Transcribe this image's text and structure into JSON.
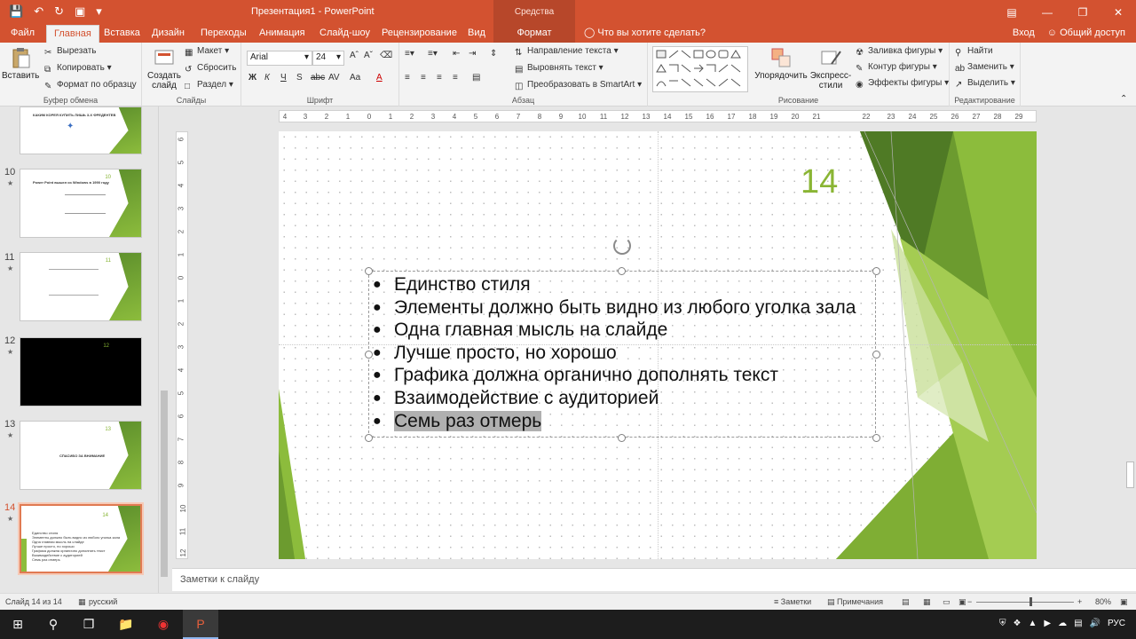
{
  "titlebar": {
    "title": "Презентация1 - PowerPoint",
    "context_group": "Средства рисования"
  },
  "tabs": {
    "items": [
      "Файл",
      "Главная",
      "Вставка",
      "Дизайн",
      "Переходы",
      "Анимация",
      "Слайд-шоу",
      "Рецензирование",
      "Вид"
    ],
    "context_tab": "Формат",
    "tell_me": "Что вы хотите сделать?",
    "signin": "Вход",
    "share": "Общий доступ"
  },
  "ribbon": {
    "clipboard": {
      "paste": "Вставить",
      "cut": "Вырезать",
      "copy": "Копировать",
      "format_painter": "Формат по образцу",
      "group": "Буфер обмена"
    },
    "slides": {
      "new_slide": "Создать слайд",
      "layout": "Макет",
      "reset": "Сбросить",
      "section": "Раздел",
      "group": "Слайды"
    },
    "font": {
      "name": "Arial",
      "size": "24",
      "group": "Шрифт"
    },
    "paragraph": {
      "text_direction": "Направление текста",
      "align_text": "Выровнять текст",
      "smartart": "Преобразовать в SmartArt",
      "group": "Абзац"
    },
    "drawing": {
      "arrange": "Упорядочить",
      "quick_styles": "Экспресс-стили",
      "fill": "Заливка фигуры",
      "outline": "Контур фигуры",
      "effects": "Эффекты фигуры",
      "group": "Рисование"
    },
    "editing": {
      "find": "Найти",
      "replace": "Заменить",
      "select": "Выделить",
      "group": "Редактирование"
    }
  },
  "thumbnails": [
    {
      "num": "",
      "title": "КАКИМ КОРЕЯ КУПИТЬ ЛИШЬ 3-Х ФРЕДЕНТЕВ",
      "kind": "white"
    },
    {
      "num": "10",
      "title": "Power Point вышел из Windows в 1990 году",
      "kind": "white"
    },
    {
      "num": "11",
      "title": "",
      "kind": "white"
    },
    {
      "num": "12",
      "title": "",
      "kind": "dark"
    },
    {
      "num": "13",
      "title": "СПАСИБО ЗА ВНИМАНИЕ",
      "kind": "white"
    },
    {
      "num": "14",
      "title": "",
      "kind": "selected"
    }
  ],
  "slide": {
    "number": "14",
    "bullets": [
      "Единство стиля",
      "Элементы должно быть видно из любого уголка зала",
      "Одна главная мысль на слайде",
      "Лучше просто, но хорошо",
      "Графика должна органично дополнять текст",
      "Взаимодействие с аудиторией",
      "Семь раз отмерь"
    ]
  },
  "notes": {
    "placeholder": "Заметки к слайду"
  },
  "status": {
    "slide_info": "Слайд 14 из 14",
    "language": "русский",
    "notes_btn": "Заметки",
    "comments_btn": "Примечания",
    "zoom": "80%"
  },
  "taskbar": {
    "lang": "РУС"
  },
  "colors": {
    "accent": "#d35230",
    "slide_number": "#8ab534"
  }
}
